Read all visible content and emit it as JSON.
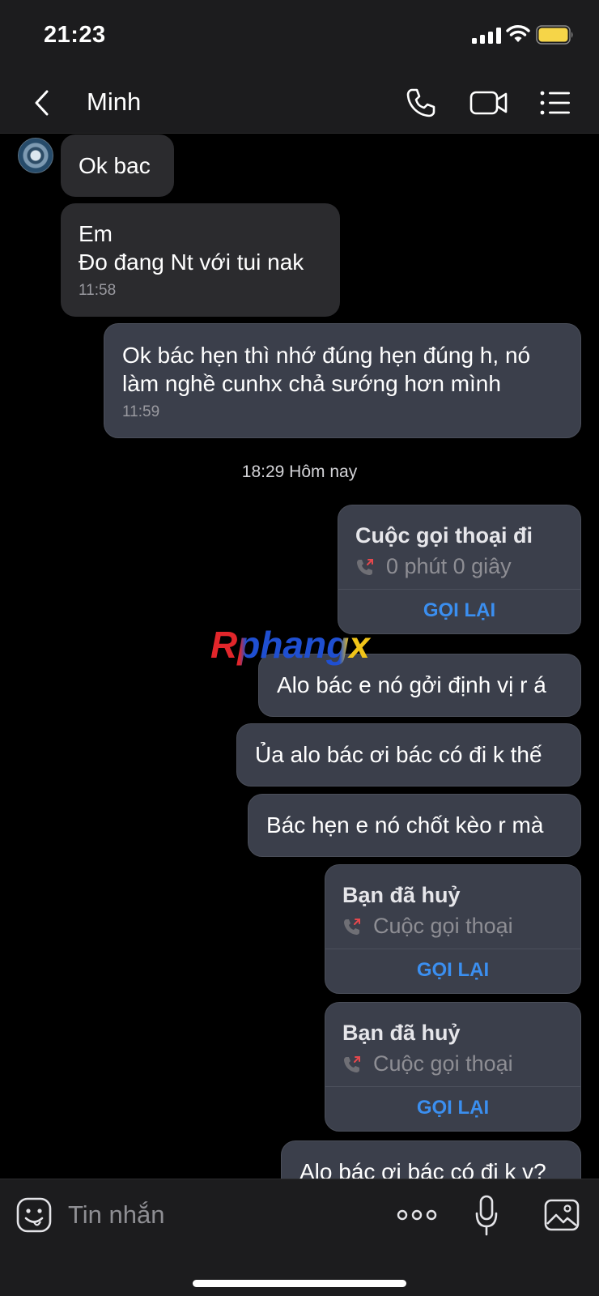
{
  "status_bar": {
    "time": "21:23"
  },
  "header": {
    "contact_name": "Minh"
  },
  "messages": [
    {
      "id": "m1",
      "direction": "incoming",
      "lines": [
        "Ok bac"
      ]
    },
    {
      "id": "m2",
      "direction": "incoming",
      "lines": [
        "Em",
        "Đo đang Nt với tui nak"
      ],
      "time": "11:58"
    },
    {
      "id": "m3",
      "direction": "outgoing",
      "lines": [
        "Ok bác hẹn thì nhớ đúng hẹn đúng h, nó",
        "làm nghề cunhx chả sướng hơn mình"
      ],
      "time": "11:59"
    }
  ],
  "date_separator": "18:29 Hôm nay",
  "call_cards": [
    {
      "id": "c1",
      "title": "Cuộc gọi thoại đi",
      "subtitle": "0 phút 0 giây",
      "action": "GỌI LẠI"
    },
    {
      "id": "c2",
      "title": "Bạn đã huỷ",
      "subtitle": "Cuộc gọi thoại",
      "action": "GỌI LẠI"
    },
    {
      "id": "c3",
      "title": "Bạn đã huỷ",
      "subtitle": "Cuộc gọi thoại",
      "action": "GỌI LẠI"
    }
  ],
  "outgoing_texts": [
    "Alo bác e nó gởi định vị r á",
    "Ủa alo bác ơi bác có đi k thế",
    "Bác hẹn e nó chốt kèo r mà",
    "Alo bác ơi bác có đi k v?"
  ],
  "watermark": "Rphangx",
  "input": {
    "placeholder": "Tin nhắn"
  },
  "colors": {
    "accent_blue": "#3b8ff0",
    "bubble_outgoing": "#3b3f4b",
    "bubble_incoming": "#2b2b2e",
    "missed_call_red": "#e5484d",
    "battery_yellow": "#f6d548"
  },
  "icons": [
    "back-icon",
    "phone-icon",
    "video-icon",
    "menu-icon",
    "emoji-icon",
    "more-icon",
    "mic-icon",
    "image-icon",
    "outgoing-call-icon"
  ]
}
